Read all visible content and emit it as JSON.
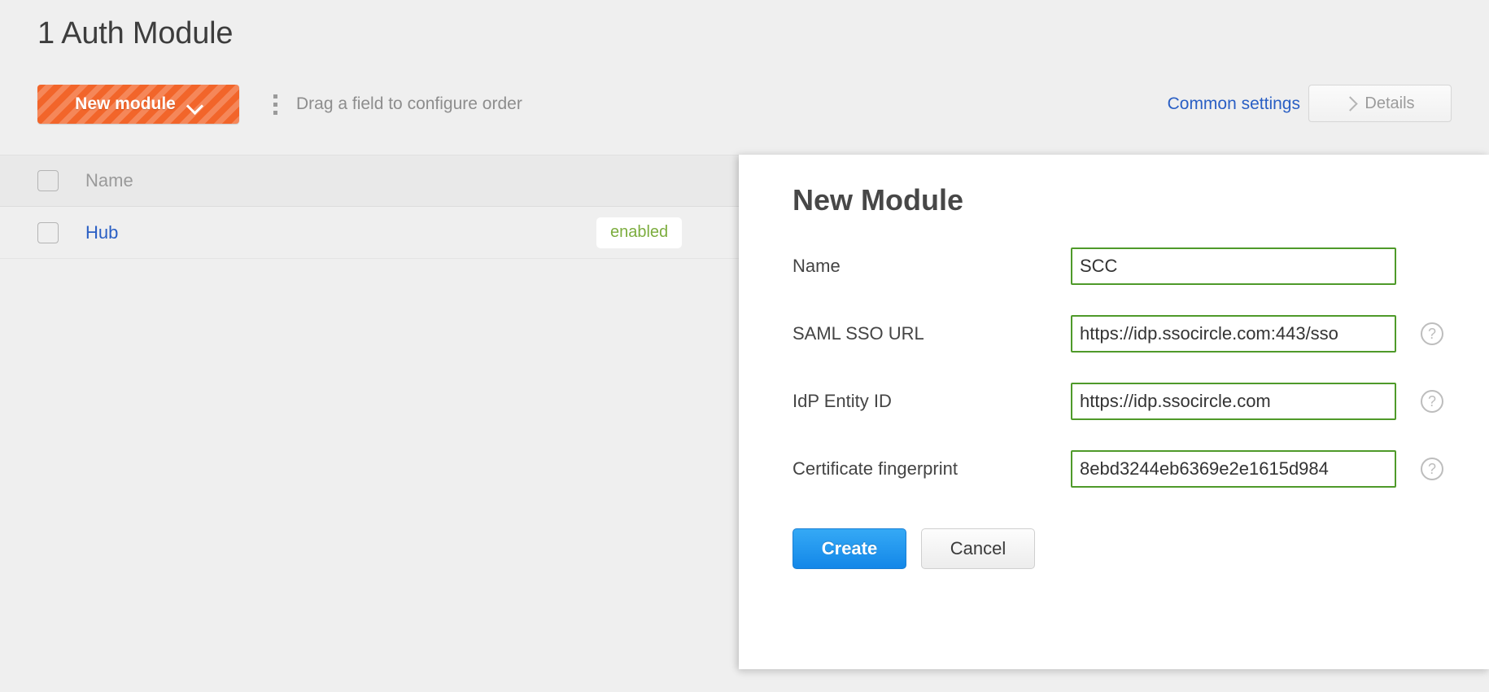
{
  "page": {
    "title": "1 Auth Module"
  },
  "toolbar": {
    "new_module_label": "New module",
    "new_module_chevron_icon": "chevron-down-icon",
    "drag_handle_icon": "drag-handle-icon",
    "drag_hint": "Drag a field to configure order",
    "common_settings_label": "Common settings",
    "details_label": "Details",
    "details_chevron_icon": "chevron-right-icon",
    "accent_color": "#f2652a",
    "link_color": "#2a5fc4"
  },
  "table": {
    "columns": [
      "Name"
    ],
    "rows": [
      {
        "name": "Hub",
        "status": "enabled",
        "status_color": "#7cad3e"
      }
    ]
  },
  "dialog": {
    "title": "New Module",
    "fields": [
      {
        "label": "Name",
        "value": "SCC",
        "has_help": false
      },
      {
        "label": "SAML SSO URL",
        "value": "https://idp.ssocircle.com:443/sso",
        "has_help": true,
        "help_icon": "help-circle-icon"
      },
      {
        "label": "IdP Entity ID",
        "value": "https://idp.ssocircle.com",
        "has_help": true,
        "help_icon": "help-circle-icon"
      },
      {
        "label": "Certificate fingerprint",
        "value": "8ebd3244eb6369e2e1615d984",
        "has_help": true,
        "help_icon": "help-circle-icon"
      }
    ],
    "create_label": "Create",
    "cancel_label": "Cancel",
    "input_border_color": "#4f9a2a",
    "create_color": "#1387e8"
  }
}
